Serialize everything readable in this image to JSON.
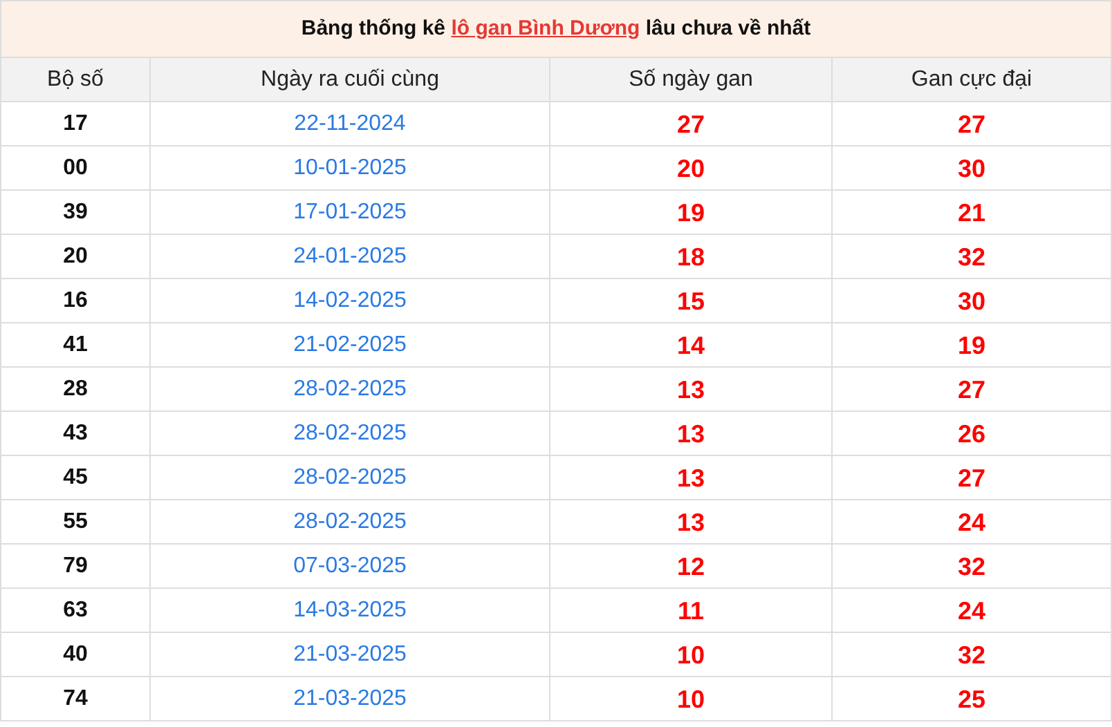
{
  "title": {
    "before": "Bảng thống kê ",
    "link": "lô gan Bình Dương",
    "after": " lâu chưa về nhất"
  },
  "table": {
    "columns": [
      "Bộ số",
      "Ngày ra cuối cùng",
      "Số ngày gan",
      "Gan cực đại"
    ],
    "rows": [
      [
        "17",
        "22-11-2024",
        "27",
        "27"
      ],
      [
        "00",
        "10-01-2025",
        "20",
        "30"
      ],
      [
        "39",
        "17-01-2025",
        "19",
        "21"
      ],
      [
        "20",
        "24-01-2025",
        "18",
        "32"
      ],
      [
        "16",
        "14-02-2025",
        "15",
        "30"
      ],
      [
        "41",
        "21-02-2025",
        "14",
        "19"
      ],
      [
        "28",
        "28-02-2025",
        "13",
        "27"
      ],
      [
        "43",
        "28-02-2025",
        "13",
        "26"
      ],
      [
        "45",
        "28-02-2025",
        "13",
        "27"
      ],
      [
        "55",
        "28-02-2025",
        "13",
        "24"
      ],
      [
        "79",
        "07-03-2025",
        "12",
        "32"
      ],
      [
        "63",
        "14-03-2025",
        "11",
        "24"
      ],
      [
        "40",
        "21-03-2025",
        "10",
        "32"
      ],
      [
        "74",
        "21-03-2025",
        "10",
        "25"
      ]
    ]
  }
}
